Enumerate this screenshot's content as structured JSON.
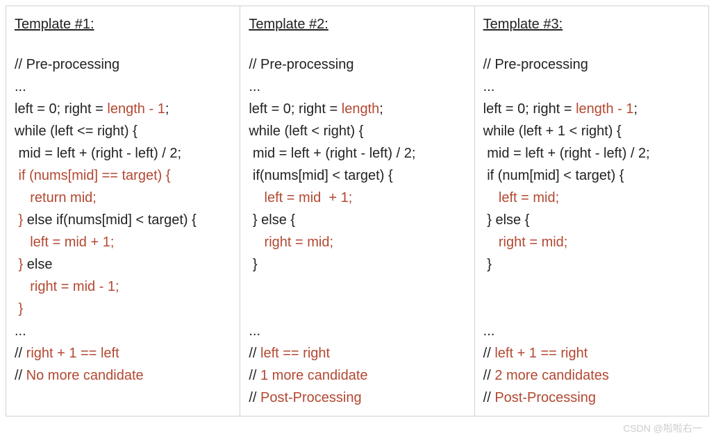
{
  "watermark": "CSDN @啦啦右一",
  "columns": [
    {
      "title": "Template #1:",
      "lines": [
        {
          "segments": [
            {
              "text": "// Pre-processing",
              "cls": "k"
            }
          ]
        },
        {
          "segments": [
            {
              "text": "...",
              "cls": "k"
            }
          ]
        },
        {
          "segments": [
            {
              "text": "left = 0; right = ",
              "cls": "k"
            },
            {
              "text": "length - 1",
              "cls": "r"
            },
            {
              "text": ";",
              "cls": "k"
            }
          ]
        },
        {
          "segments": [
            {
              "text": "while (left <= right) {",
              "cls": "k"
            }
          ]
        },
        {
          "segments": [
            {
              "text": " mid = left + (right - left) / 2;",
              "cls": "k"
            }
          ]
        },
        {
          "segments": [
            {
              "text": " if (nums[mid] == target) {",
              "cls": "r"
            }
          ]
        },
        {
          "segments": [
            {
              "text": "    return mid;",
              "cls": "r"
            }
          ]
        },
        {
          "segments": [
            {
              "text": " }",
              "cls": "r"
            },
            {
              "text": " else if(nums[mid] < target) {",
              "cls": "k"
            }
          ]
        },
        {
          "segments": [
            {
              "text": "    left = mid + 1;",
              "cls": "r"
            }
          ]
        },
        {
          "segments": [
            {
              "text": " }",
              "cls": "r"
            },
            {
              "text": " else",
              "cls": "k"
            }
          ]
        },
        {
          "segments": [
            {
              "text": "    right = mid - 1;",
              "cls": "r"
            }
          ]
        },
        {
          "segments": [
            {
              "text": " }",
              "cls": "r"
            }
          ]
        },
        {
          "segments": [
            {
              "text": "...",
              "cls": "k"
            }
          ]
        },
        {
          "segments": [
            {
              "text": "// ",
              "cls": "k"
            },
            {
              "text": "right + 1 == left",
              "cls": "r"
            }
          ]
        },
        {
          "segments": [
            {
              "text": "// ",
              "cls": "k"
            },
            {
              "text": "No more candidate",
              "cls": "r"
            }
          ]
        }
      ]
    },
    {
      "title": "Template #2:",
      "lines": [
        {
          "segments": [
            {
              "text": "// Pre-processing",
              "cls": "k"
            }
          ]
        },
        {
          "segments": [
            {
              "text": "...",
              "cls": "k"
            }
          ]
        },
        {
          "segments": [
            {
              "text": "left = 0; right = ",
              "cls": "k"
            },
            {
              "text": "length",
              "cls": "r"
            },
            {
              "text": ";",
              "cls": "k"
            }
          ]
        },
        {
          "segments": [
            {
              "text": "while (left < right) {",
              "cls": "k"
            }
          ]
        },
        {
          "segments": [
            {
              "text": " mid = left + (right - left) / 2;",
              "cls": "k"
            }
          ]
        },
        {
          "segments": [
            {
              "text": " if(nums[mid] < target) {",
              "cls": "k"
            }
          ]
        },
        {
          "segments": [
            {
              "text": "    left = mid  + 1;",
              "cls": "r"
            }
          ]
        },
        {
          "segments": [
            {
              "text": " } else {",
              "cls": "k"
            }
          ]
        },
        {
          "segments": [
            {
              "text": "    right = mid;",
              "cls": "r"
            }
          ]
        },
        {
          "segments": [
            {
              "text": " }",
              "cls": "k"
            }
          ]
        },
        {
          "segments": [
            {
              "text": "",
              "cls": "k"
            }
          ],
          "blank": true
        },
        {
          "segments": [
            {
              "text": "",
              "cls": "k"
            }
          ],
          "blank": true
        },
        {
          "segments": [
            {
              "text": "...",
              "cls": "k"
            }
          ]
        },
        {
          "segments": [
            {
              "text": "// ",
              "cls": "k"
            },
            {
              "text": "left == right",
              "cls": "r"
            }
          ]
        },
        {
          "segments": [
            {
              "text": "// ",
              "cls": "k"
            },
            {
              "text": "1 more candidate",
              "cls": "r"
            }
          ]
        },
        {
          "segments": [
            {
              "text": "// ",
              "cls": "k"
            },
            {
              "text": "Post-Processing",
              "cls": "r"
            }
          ]
        }
      ]
    },
    {
      "title": " Template #3:",
      "lines": [
        {
          "segments": [
            {
              "text": "// Pre-processing",
              "cls": "k"
            }
          ]
        },
        {
          "segments": [
            {
              "text": "...",
              "cls": "k"
            }
          ]
        },
        {
          "segments": [
            {
              "text": "left = 0; right = ",
              "cls": "k"
            },
            {
              "text": "length - 1",
              "cls": "r"
            },
            {
              "text": ";",
              "cls": "k"
            }
          ]
        },
        {
          "segments": [
            {
              "text": "while (left + 1 < right) {",
              "cls": "k"
            }
          ]
        },
        {
          "segments": [
            {
              "text": " mid = left + (right - left) / 2;",
              "cls": "k"
            }
          ]
        },
        {
          "segments": [
            {
              "text": " if (num[mid] < target) {",
              "cls": "k"
            }
          ]
        },
        {
          "segments": [
            {
              "text": "    left = mid;",
              "cls": "r"
            }
          ]
        },
        {
          "segments": [
            {
              "text": " } else {",
              "cls": "k"
            }
          ]
        },
        {
          "segments": [
            {
              "text": "    right = mid;",
              "cls": "r"
            }
          ]
        },
        {
          "segments": [
            {
              "text": " }",
              "cls": "k"
            }
          ]
        },
        {
          "segments": [
            {
              "text": "",
              "cls": "k"
            }
          ],
          "blank": true
        },
        {
          "segments": [
            {
              "text": "",
              "cls": "k"
            }
          ],
          "blank": true
        },
        {
          "segments": [
            {
              "text": "...",
              "cls": "k"
            }
          ]
        },
        {
          "segments": [
            {
              "text": "// ",
              "cls": "k"
            },
            {
              "text": "left + 1 == right",
              "cls": "r"
            }
          ]
        },
        {
          "segments": [
            {
              "text": "// ",
              "cls": "k"
            },
            {
              "text": "2 more candidates",
              "cls": "r"
            }
          ]
        },
        {
          "segments": [
            {
              "text": "// ",
              "cls": "k"
            },
            {
              "text": "Post-Processing",
              "cls": "r"
            }
          ]
        }
      ]
    }
  ]
}
